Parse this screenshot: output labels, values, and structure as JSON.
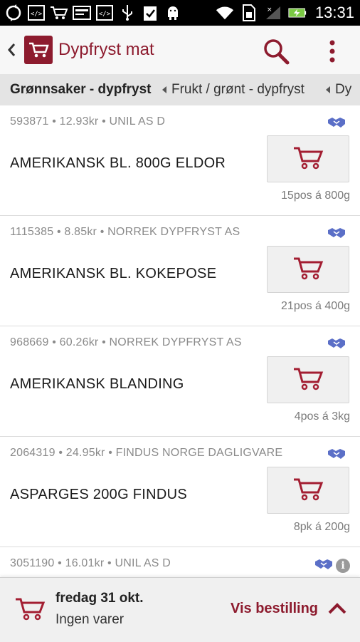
{
  "status_bar": {
    "time": "13:31",
    "left_icons": [
      "sync-icon",
      "code-icon",
      "shopping-cart-icon",
      "card-icon",
      "code-icon",
      "usb-icon",
      "clipboard-check-icon",
      "android-debug-icon"
    ],
    "right_icons": [
      "wifi-icon",
      "sim-card-icon",
      "signal-icon",
      "battery-charging-icon"
    ]
  },
  "app_bar": {
    "title": "Dypfryst mat",
    "accent_color": "#8d1b2e"
  },
  "categories": [
    {
      "label": "Grønnsaker - dypfryst",
      "active": true
    },
    {
      "label": "Frukt / grønt - dypfryst",
      "active": false
    },
    {
      "label": "Dy",
      "active": false
    }
  ],
  "products": [
    {
      "meta": "593871 • 12.93kr • UNIL AS D",
      "name": "AMERIKANSK BL. 800G ELDOR",
      "pack": "15pos á 800g"
    },
    {
      "meta": "1115385 • 8.85kr • NORREK DYPFRYST  AS",
      "name": "AMERIKANSK BL. KOKEPOSE",
      "pack": "21pos á 400g"
    },
    {
      "meta": "968669 • 60.26kr • NORREK DYPFRYST  AS",
      "name": "AMERIKANSK BLANDING",
      "pack": "4pos á 3kg"
    },
    {
      "meta": "2064319 • 24.95kr • FINDUS NORGE DAGLIGVARE",
      "name": "ASPARGES 200G FINDUS",
      "pack": "8pk á 200g"
    },
    {
      "meta": "3051190 • 16.01kr • UNIL AS D",
      "name": "",
      "pack": ""
    }
  ],
  "bottom_bar": {
    "date": "fredag 31 okt.",
    "status": "Ingen varer",
    "action": "Vis bestilling"
  }
}
